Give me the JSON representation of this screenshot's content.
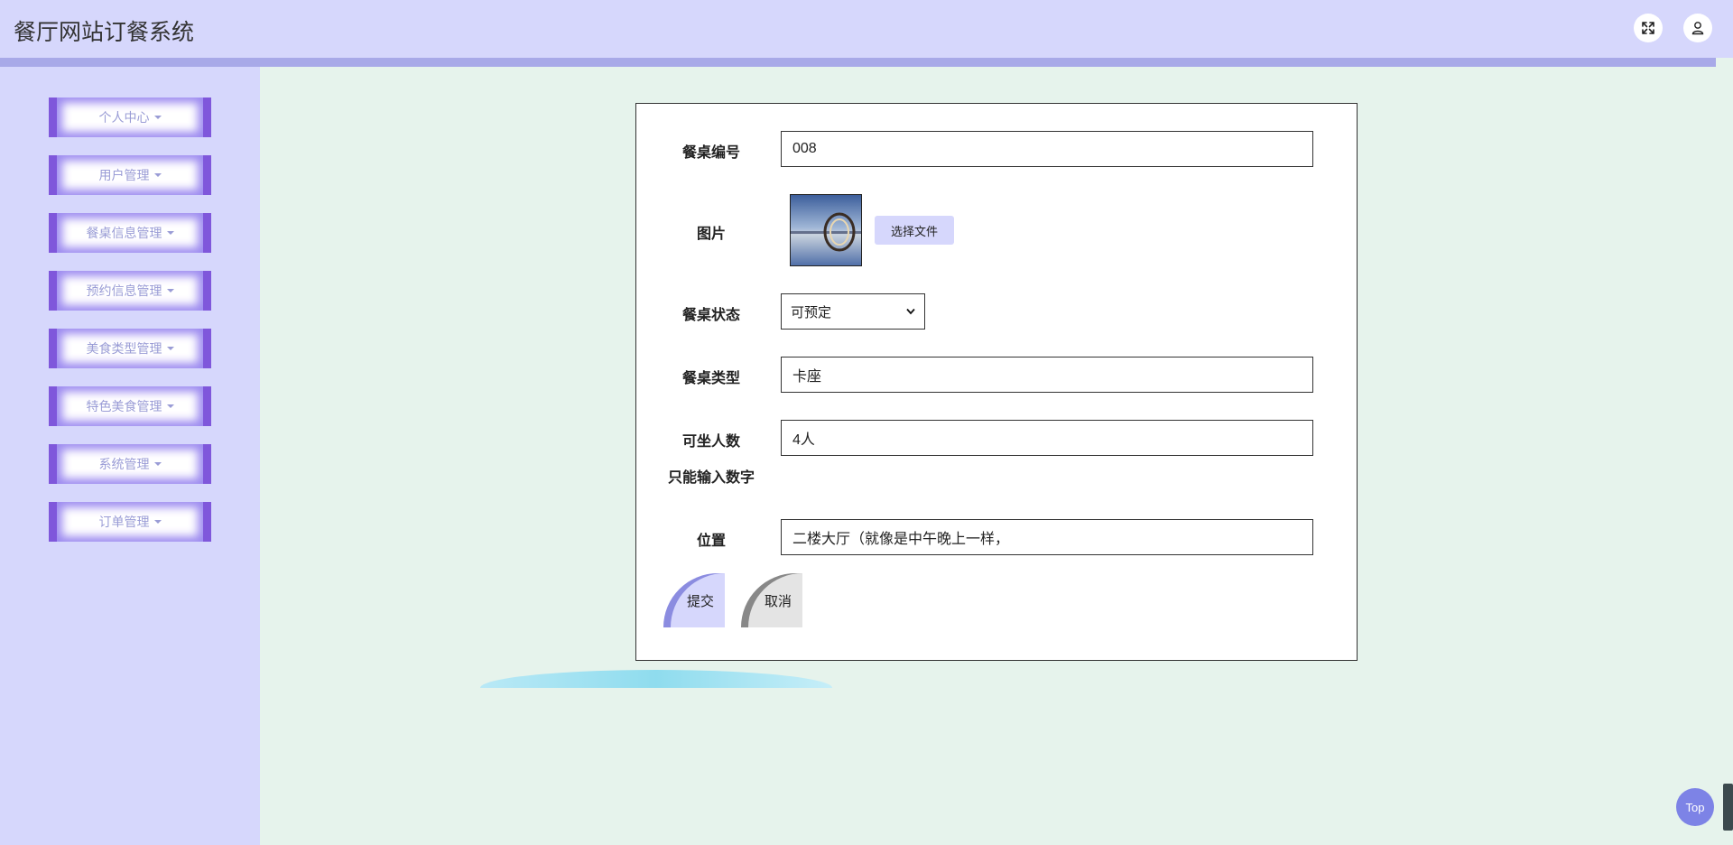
{
  "app": {
    "title": "餐厅网站订餐系统"
  },
  "header": {
    "icons": [
      "fullscreen-icon",
      "user-icon"
    ]
  },
  "sidebar": {
    "items": [
      {
        "label": "个人中心"
      },
      {
        "label": "用户管理"
      },
      {
        "label": "餐桌信息管理"
      },
      {
        "label": "预约信息管理"
      },
      {
        "label": "美食类型管理"
      },
      {
        "label": "特色美食管理"
      },
      {
        "label": "系统管理"
      },
      {
        "label": "订单管理"
      }
    ]
  },
  "form": {
    "table_no": {
      "label": "餐桌编号",
      "value": "008"
    },
    "image": {
      "label": "图片",
      "button": "选择文件"
    },
    "status": {
      "label": "餐桌状态",
      "value": "可预定"
    },
    "type": {
      "label": "餐桌类型",
      "value": "卡座"
    },
    "seats": {
      "label": "可坐人数",
      "value": "4人",
      "hint": "只能输入数字"
    },
    "location": {
      "label": "位置",
      "value": "二楼大厅（就像是中午晚上一样，"
    },
    "submit": "提交",
    "cancel": "取消"
  },
  "top_button": "Top"
}
